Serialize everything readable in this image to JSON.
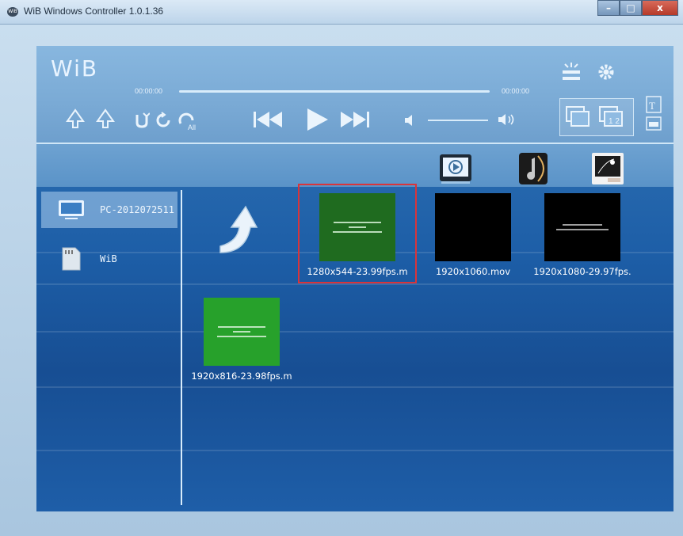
{
  "window": {
    "title": "WiB Windows Controller 1.0.1.36",
    "app_icon_text": "WiB",
    "minimize_label": "–",
    "maximize_label": "□",
    "close_label": "x"
  },
  "toolbar": {
    "logo": "WiB",
    "time_elapsed": "00:00:00",
    "time_total": "00:00:00",
    "progress": 0
  },
  "sidebar": {
    "items": [
      {
        "label": "PC-2012072511",
        "icon": "monitor-icon",
        "selected": true
      },
      {
        "label": "WiB",
        "icon": "sd-card-icon",
        "selected": false
      }
    ]
  },
  "tabs": [
    {
      "icon": "video-icon",
      "selected": true
    },
    {
      "icon": "music-icon",
      "selected": false
    },
    {
      "icon": "photo-icon",
      "selected": false
    }
  ],
  "files": [
    {
      "name": "1280x544-23.99fps.m",
      "thumb": "green",
      "selected": true
    },
    {
      "name": "1920x1060.mov",
      "thumb": "black",
      "selected": false
    },
    {
      "name": "1920x1080-29.97fps.",
      "thumb": "black-text",
      "selected": false
    },
    {
      "name": "1920x816-23.98fps.m",
      "thumb": "green-bright",
      "selected": false
    }
  ],
  "colors": {
    "selection_border": "#d9343a",
    "thumb_green_dark": "#1f6b1f",
    "thumb_green_bright": "#27a12b"
  }
}
